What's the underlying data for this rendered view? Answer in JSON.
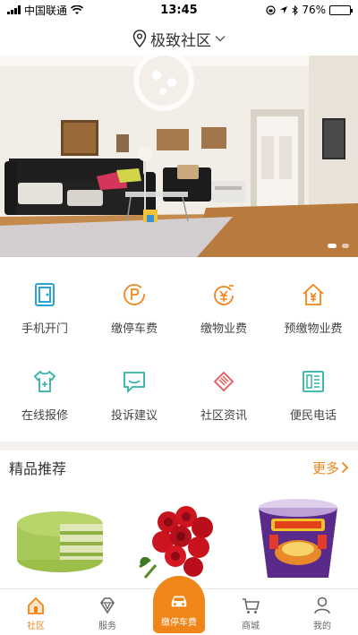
{
  "status_bar": {
    "carrier": "中国联通",
    "time": "13:45",
    "battery_percent": "76%",
    "battery_level": 0.76
  },
  "header": {
    "location_name": "极致社区"
  },
  "banner": {
    "slide_count": 2,
    "active_slide": 1
  },
  "services": [
    {
      "label": "手机开门",
      "icon": "door-icon",
      "color": "#29a3d6"
    },
    {
      "label": "缴停车费",
      "icon": "parking-coin-icon",
      "color": "#f08519"
    },
    {
      "label": "缴物业费",
      "icon": "property-fee-icon",
      "color": "#f08519"
    },
    {
      "label": "预缴物业费",
      "icon": "house-coin-icon",
      "color": "#f08519"
    },
    {
      "label": "在线报修",
      "icon": "repair-shirt-icon",
      "color": "#2fb3a6"
    },
    {
      "label": "投诉建议",
      "icon": "chat-icon",
      "color": "#2fb3a6"
    },
    {
      "label": "社区资讯",
      "icon": "news-icon",
      "color": "#e4555b"
    },
    {
      "label": "便民电话",
      "icon": "phone-icon",
      "color": "#2fb3a6"
    }
  ],
  "featured": {
    "title": "精品推荐",
    "more_label": "更多",
    "products": [
      {
        "icon": "matcha-cake-image"
      },
      {
        "icon": "rose-bouquet-image"
      },
      {
        "icon": "instant-noodle-cup-image"
      }
    ]
  },
  "tabbar": {
    "tabs": [
      {
        "label": "社区",
        "icon": "community-home-icon",
        "active": true
      },
      {
        "label": "服务",
        "icon": "diamond-icon",
        "active": false
      },
      {
        "label": "缴停车费",
        "icon": "car-icon",
        "active": false,
        "center": true
      },
      {
        "label": "商城",
        "icon": "cart-icon",
        "active": false
      },
      {
        "label": "我的",
        "icon": "person-icon",
        "active": false
      }
    ]
  },
  "colors": {
    "accent": "#f08519",
    "teal": "#2fb3a6",
    "blue": "#29a3d6",
    "red": "#e4555b"
  }
}
